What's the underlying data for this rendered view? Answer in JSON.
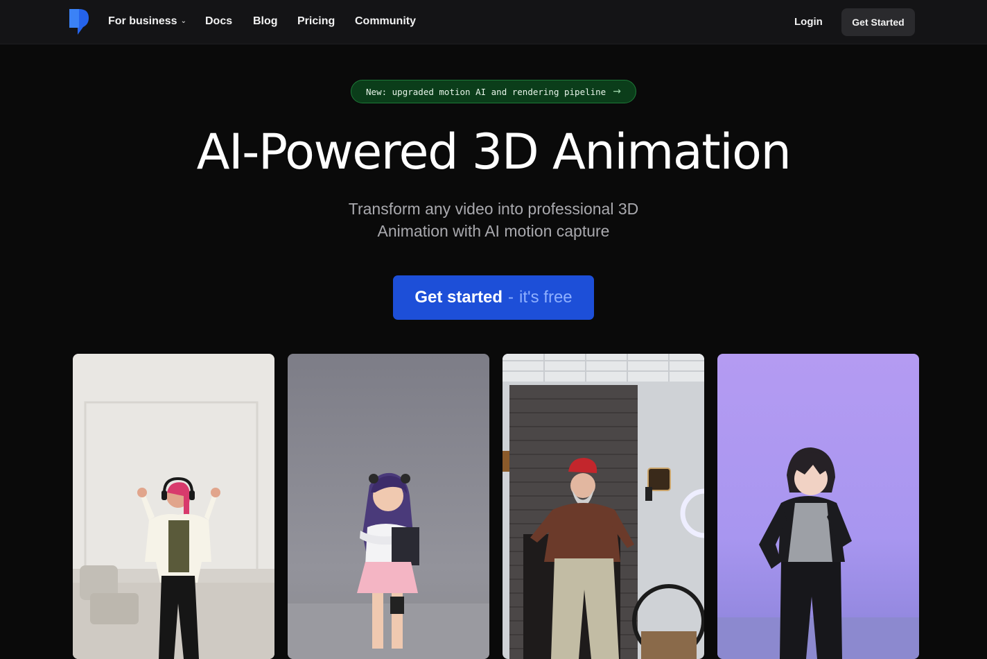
{
  "nav": {
    "logo_icon": "brand-logo-icon",
    "links": [
      {
        "label": "For business",
        "has_dropdown": true
      },
      {
        "label": "Docs"
      },
      {
        "label": "Blog"
      },
      {
        "label": "Pricing"
      },
      {
        "label": "Community"
      }
    ],
    "dropdown_icon": "chevron-down-icon",
    "login_label": "Login",
    "get_started_label": "Get Started"
  },
  "announcement": {
    "text": "New: upgraded motion AI and rendering pipeline",
    "icon": "arrow-right-icon"
  },
  "hero": {
    "title": "AI-Powered 3D Animation",
    "subtitle": "Transform any video into professional 3D Animation with AI motion capture",
    "cta_main": "Get started",
    "cta_sep": "-",
    "cta_free": "it's free"
  },
  "showcase": {
    "cards": [
      {
        "name": "showcase-card-woman-dancing"
      },
      {
        "name": "showcase-card-anime-girl"
      },
      {
        "name": "showcase-card-man-dancing"
      },
      {
        "name": "showcase-card-anime-boy"
      }
    ]
  },
  "colors": {
    "background": "#0a0a0a",
    "navbar": "#141416",
    "cta": "#1d4fd8",
    "announce_bg": "#0b3d1a",
    "announce_border": "#1d7a38",
    "logo": "#2563eb"
  }
}
